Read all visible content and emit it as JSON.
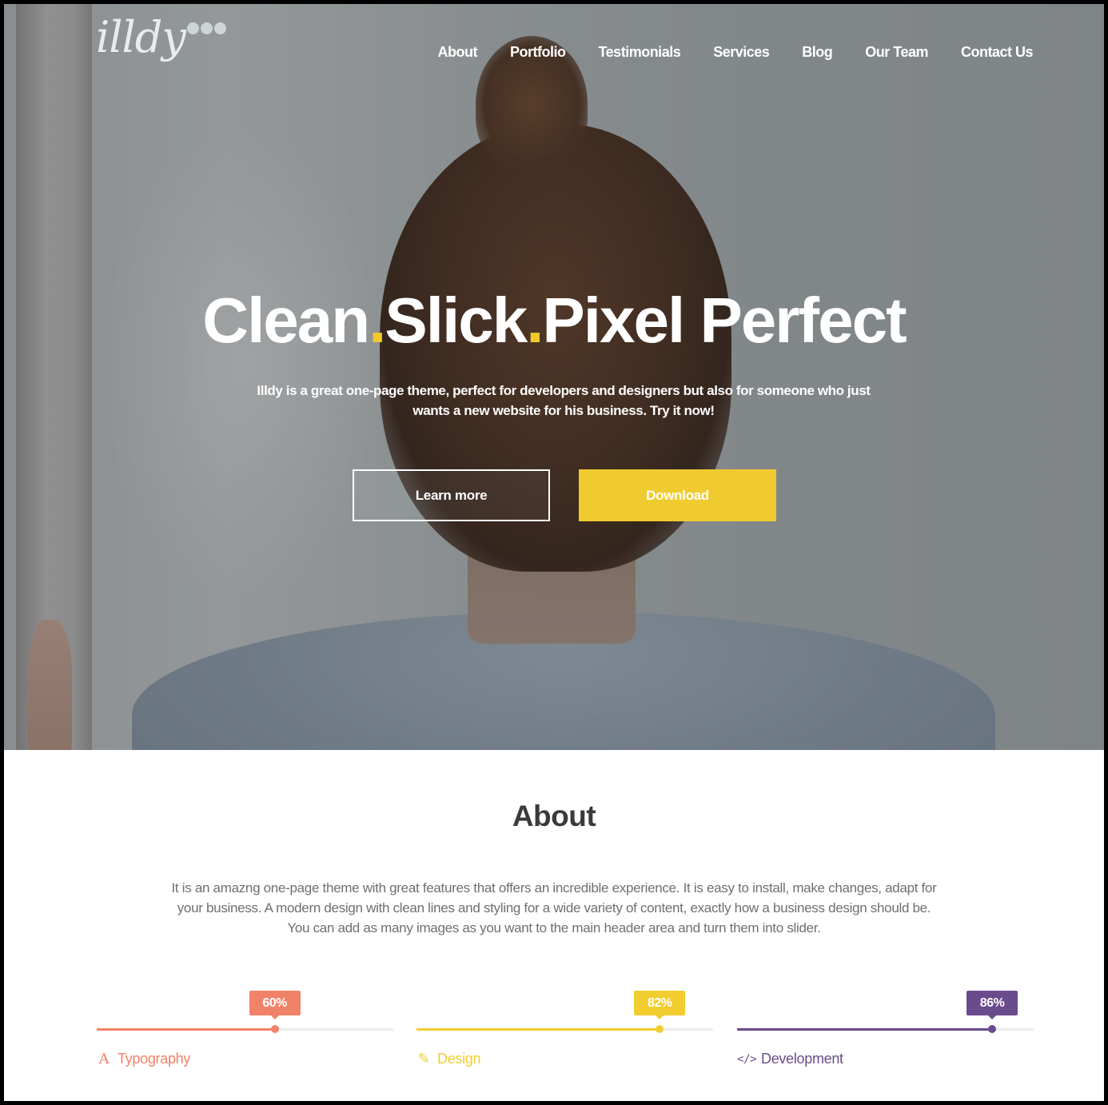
{
  "logo": {
    "text": "illdy"
  },
  "nav": {
    "items": [
      "About",
      "Portfolio",
      "Testimonials",
      "Services",
      "Blog",
      "Our Team",
      "Contact Us"
    ]
  },
  "hero": {
    "headline_parts": [
      "Clean",
      ".",
      "Slick",
      ".",
      "Pixel Perfect"
    ],
    "subtitle": "Illdy is a great one-page theme, perfect for developers and designers but also for someone who just wants a new website for his business. Try it now!",
    "learn_more_label": "Learn more",
    "download_label": "Download",
    "accent_color": "#f0cb2f"
  },
  "about": {
    "title": "About",
    "text": "It is an amazng one-page theme with great features that offers an incredible experience. It is easy to install, make changes, adapt for your business. A modern design with clean lines and styling for a wide variety of content, exactly how a business design should be. You can add as many images as you want to the main header area and turn them into slider.",
    "skills": [
      {
        "label": "Typography",
        "percent_label": "60%",
        "progress": 0.6,
        "color": "#f1826a",
        "icon": "typography-icon"
      },
      {
        "label": "Design",
        "percent_label": "82%",
        "progress": 0.82,
        "color": "#f2cd2f",
        "icon": "pencil-icon"
      },
      {
        "label": "Development",
        "percent_label": "86%",
        "progress": 0.86,
        "color": "#6a4b8c",
        "icon": "code-icon"
      }
    ]
  }
}
